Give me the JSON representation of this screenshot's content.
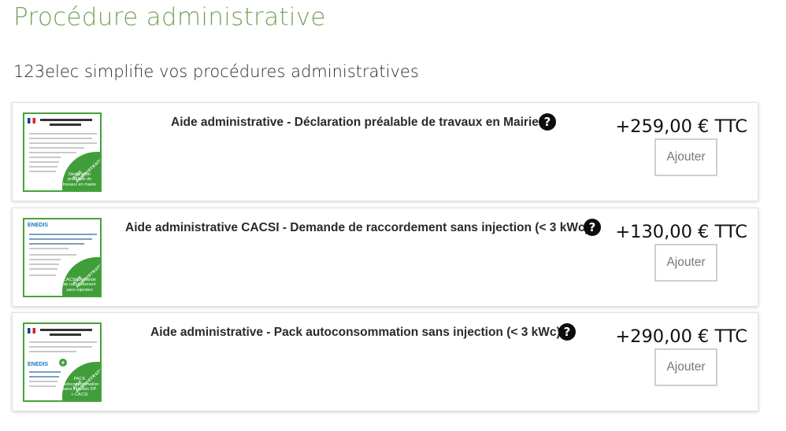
{
  "page": {
    "title": "Procédure administrative",
    "subtitle": "123elec simplifie vos procédures administratives"
  },
  "colors": {
    "title_green": "#7aa35a",
    "thumb_green": "#3f9e3a",
    "button_border": "#cfcfcf"
  },
  "products": [
    {
      "title": "Aide administrative - Déclaration préalable de travaux en Mairie",
      "price": "+259,00 € TTC",
      "button_label": "Ajouter",
      "help_icon": "question-circle-icon",
      "thumb": {
        "header": "Récépissé de dépôt d'une déclaration préalable",
        "badge": "AIDE ADMINISTRATIVE",
        "caption": "Déclaration préalable de travaux en mairie"
      }
    },
    {
      "title": "Aide administrative CACSI - Demande de raccordement sans injection (< 3 kWc)",
      "price": "+130,00 € TTC",
      "button_label": "Ajouter",
      "help_icon": "question-circle-icon",
      "thumb": {
        "header": "ENEDIS",
        "badge": "AIDE ADMINISTRATIVE",
        "caption": "CACSI Demande de raccordement sans injection"
      }
    },
    {
      "title": "Aide administrative - Pack autoconsommation sans injection (< 3 kWc)",
      "price": "+290,00 € TTC",
      "button_label": "Ajouter",
      "help_icon": "question-circle-icon",
      "thumb": {
        "header": "ENEDIS",
        "badge": "AIDE ADMINISTRATIVE",
        "caption": "PACK autoconsommation sans injection DP + CACSI"
      }
    }
  ]
}
